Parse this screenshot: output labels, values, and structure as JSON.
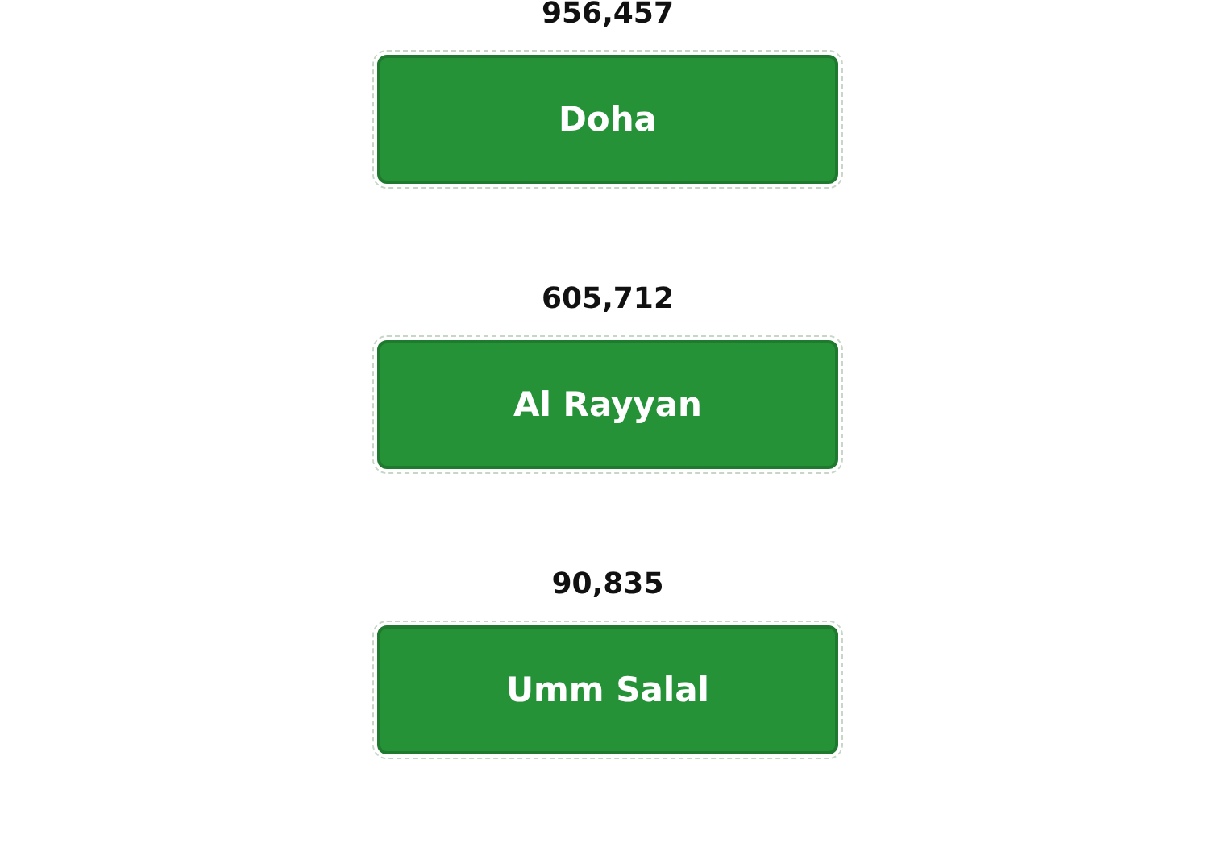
{
  "cities": [
    {
      "count": "956,457",
      "name": "Doha"
    },
    {
      "count": "605,712",
      "name": "Al Rayyan"
    },
    {
      "count": "90,835",
      "name": "Umm Salal"
    }
  ]
}
